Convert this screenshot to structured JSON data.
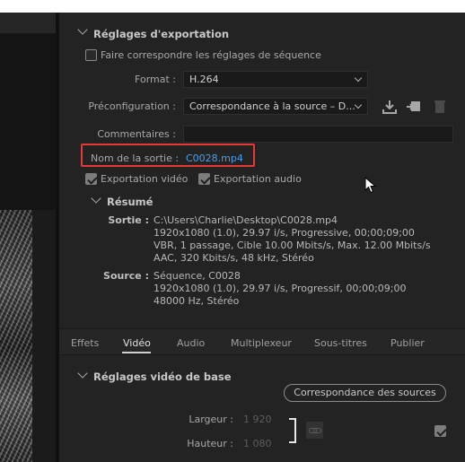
{
  "export_settings": {
    "section_title": "Réglages d'exportation",
    "match_sequence_label": "Faire correspondre les réglages de séquence",
    "match_sequence_checked": false,
    "format_label": "Format :",
    "format_value": "H.264",
    "preset_label": "Préconfiguration :",
    "preset_value": "Correspondance à la source – D...",
    "comments_label": "Commentaires :",
    "comments_value": "",
    "output_name_label": "Nom de la sortie :",
    "output_name_value": "C0028.mp4",
    "export_video_label": "Exportation vidéo",
    "export_video_checked": true,
    "export_audio_label": "Exportation audio",
    "export_audio_checked": true,
    "icons": [
      "save-preset-icon",
      "import-preset-icon",
      "delete-preset-icon"
    ]
  },
  "summary": {
    "title": "Résumé",
    "output_key": "Sortie :",
    "output_lines": [
      "C:\\Users\\Charlie\\Desktop\\C0028.mp4",
      "1920x1080 (1.0), 29.97 i/s, Progressive, 00;00;09;00",
      "VBR, 1 passage, Cible 10.00  Mbits/s, Max. 12.00  Mbits/s",
      "AAC, 320  Kbits/s, 48  kHz, Stéréo"
    ],
    "source_key": "Source :",
    "source_lines": [
      "Séquence, C0028",
      "1920x1080 (1.0), 29.97  i/s, Progressif, 00;00;09;00",
      "48000 Hz, Stéréo"
    ]
  },
  "tabs": {
    "items": [
      "Effets",
      "Vidéo",
      "Audio",
      "Multiplexeur",
      "Sous-titres",
      "Publier"
    ],
    "active": "Vidéo"
  },
  "basic_video": {
    "section_title": "Réglages vidéo de base",
    "match_source_button": "Correspondance des sources",
    "width_label": "Largeur :",
    "width_value": "1 920",
    "height_label": "Hauteur :",
    "height_value": "1 080",
    "checkbox_checked": true
  },
  "colors": {
    "panel_bg": "#232323",
    "link": "#4a9fe8",
    "highlight": "#e53935"
  }
}
